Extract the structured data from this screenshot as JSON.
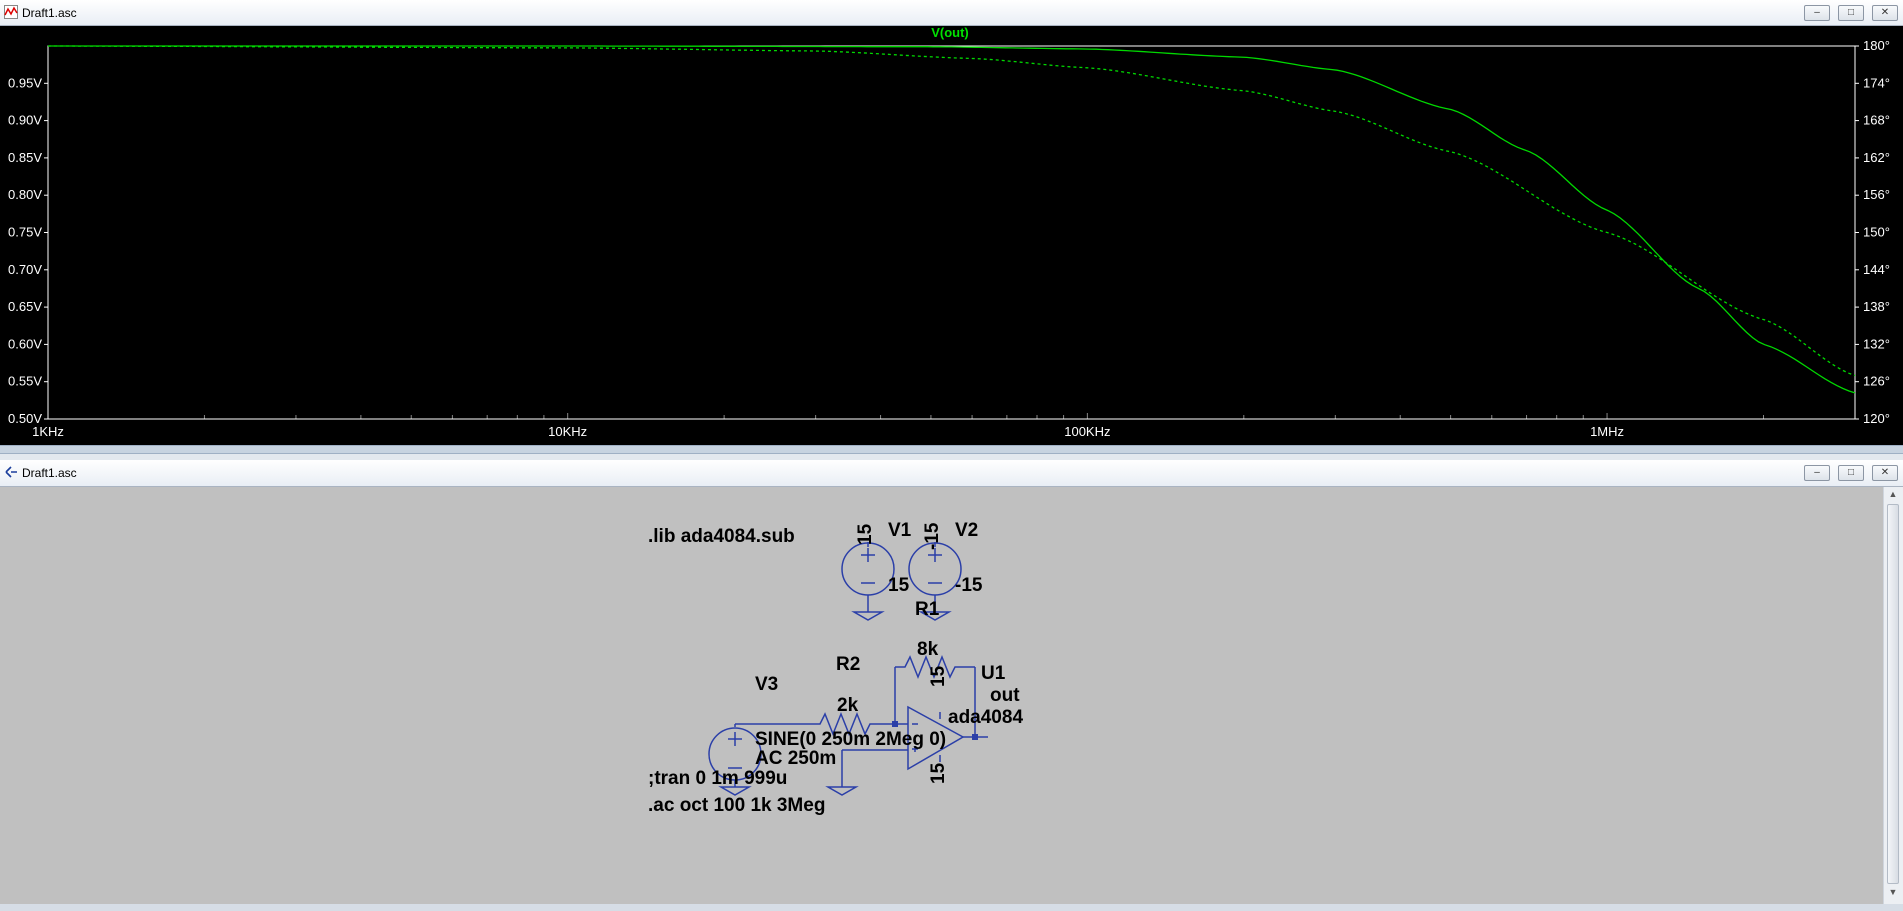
{
  "waveform_window": {
    "title": "Draft1.asc",
    "buttons": {
      "minimize": "–",
      "maximize": "□",
      "close": "✕"
    },
    "trace_label": "V(out)"
  },
  "schematic_window": {
    "title": "Draft1.asc",
    "buttons": {
      "minimize": "–",
      "maximize": "□",
      "close": "✕"
    }
  },
  "colors": {
    "plot_background": "#000000",
    "trace": "#00d800",
    "wire": "#2b3fa8",
    "schematic_background": "#c0c0c0"
  },
  "chart_data": {
    "type": "line",
    "x_scale": "log",
    "x_range_hz": [
      1000,
      3000000
    ],
    "x_ticks": [
      "1KHz",
      "10KHz",
      "100KHz",
      "1MHz"
    ],
    "y_left_ticks": [
      "0.50V",
      "0.55V",
      "0.60V",
      "0.65V",
      "0.70V",
      "0.75V",
      "0.80V",
      "0.85V",
      "0.90V",
      "0.95V"
    ],
    "y_left_range": [
      0.5,
      1.0
    ],
    "y_right_ticks": [
      "120°",
      "126°",
      "132°",
      "138°",
      "144°",
      "150°",
      "156°",
      "162°",
      "168°",
      "174°",
      "180°"
    ],
    "y_right_range": [
      120,
      180
    ],
    "series": [
      {
        "name": "V(out)",
        "style": "solid",
        "x": [
          1000,
          10000,
          50000,
          100000,
          200000,
          300000,
          500000,
          700000,
          1000000,
          1500000,
          2000000,
          3000000
        ],
        "y": [
          1.0,
          1.0,
          0.999,
          0.996,
          0.985,
          0.968,
          0.915,
          0.86,
          0.78,
          0.675,
          0.6,
          0.535
        ]
      },
      {
        "name": "phase",
        "style": "dashed",
        "x": [
          1000,
          10000,
          30000,
          60000,
          100000,
          200000,
          300000,
          500000,
          1000000,
          2000000,
          3000000
        ],
        "y": [
          180,
          179.7,
          179.2,
          178,
          176.5,
          172.8,
          169.5,
          163,
          150,
          136,
          127
        ]
      }
    ]
  },
  "schematic": {
    "directive_lib": ".lib ada4084.sub",
    "directive_tran": ";tran 0 1m 999u",
    "directive_ac": ".ac oct 100 1k 3Meg",
    "v1": {
      "name": "V1",
      "value": "15",
      "top_label": "15"
    },
    "v2": {
      "name": "V2",
      "value": "-15",
      "top_label": "-15"
    },
    "v3": {
      "name": "V3",
      "line1": "SINE(0 250m 2Meg 0)",
      "line2": "AC 250m"
    },
    "r1": {
      "name": "R1",
      "value": "8k"
    },
    "r2": {
      "name": "R2",
      "value": "2k"
    },
    "u1": {
      "name": "U1",
      "model": "ada4084",
      "supply_pos": "15",
      "supply_neg": "15"
    },
    "net_out": "out"
  }
}
